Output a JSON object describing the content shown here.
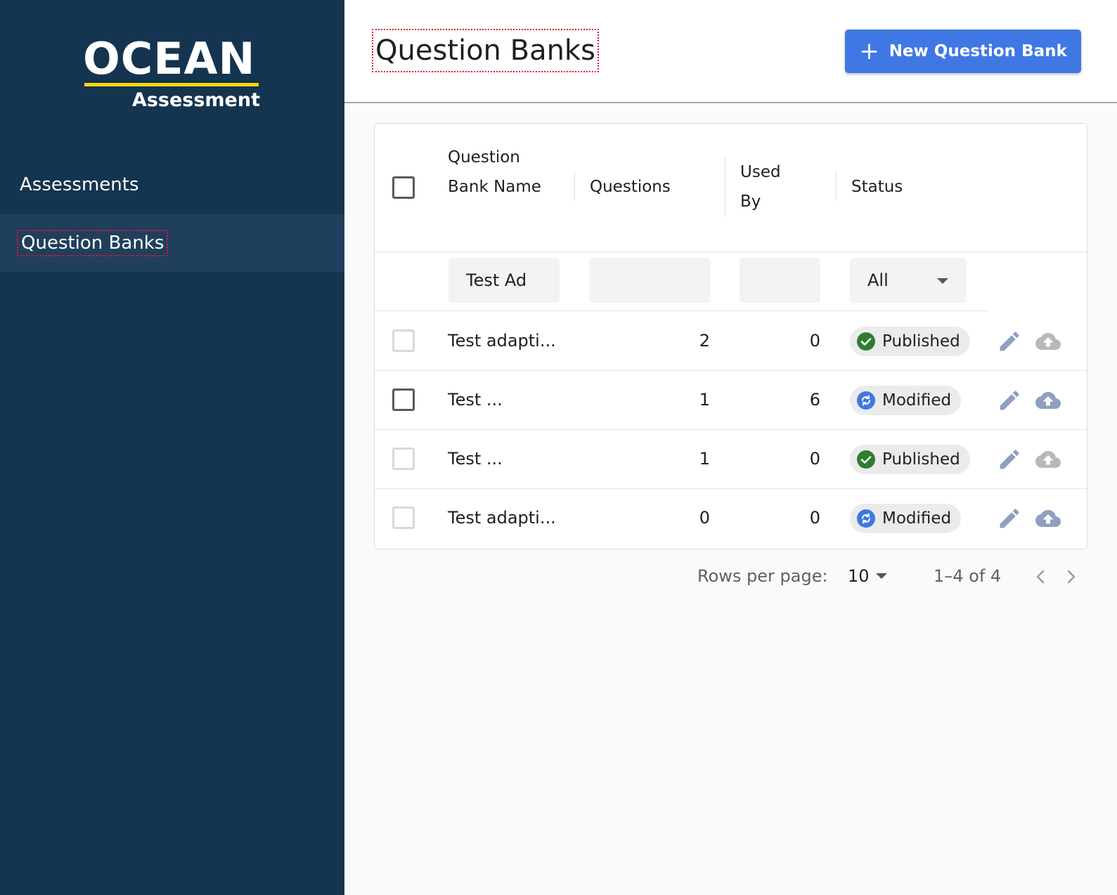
{
  "sidebar": {
    "logo": {
      "brand": "OCEAN",
      "subtitle": "Assessment",
      "accent_color": "#f5d90a"
    },
    "items": [
      {
        "label": "Assessments",
        "active": false
      },
      {
        "label": "Question Banks",
        "active": true
      }
    ]
  },
  "header": {
    "title": "Question Banks",
    "new_button_label": "New Question Bank",
    "new_button_icon": "plus-icon",
    "accent_color": "#3f78e4"
  },
  "table": {
    "columns": {
      "name": "Question Bank Name",
      "questions": "Questions",
      "used_by": "Used By",
      "status": "Status"
    },
    "filters": {
      "name": "Test Ad",
      "questions": "",
      "used_by": "",
      "status": "All"
    },
    "rows": [
      {
        "name": "Test adapti...",
        "questions": "2",
        "used_by": "0",
        "status": "Published",
        "status_icon": "check-circle-icon",
        "checkbox_style": "light"
      },
      {
        "name": "Test ...",
        "questions": "1",
        "used_by": "6",
        "status": "Modified",
        "status_icon": "sync-circle-icon",
        "checkbox_style": "dark"
      },
      {
        "name": "Test ...",
        "questions": "1",
        "used_by": "0",
        "status": "Published",
        "status_icon": "check-circle-icon",
        "checkbox_style": "light"
      },
      {
        "name": "Test adapti...",
        "questions": "0",
        "used_by": "0",
        "status": "Modified",
        "status_icon": "sync-circle-icon",
        "checkbox_style": "light"
      }
    ],
    "status_colors": {
      "Published": "#2e7d32",
      "Modified": "#3f78e4"
    }
  },
  "pagination": {
    "rows_per_page_label": "Rows per page:",
    "rows_per_page_value": "10",
    "range_text": "1–4 of 4"
  }
}
